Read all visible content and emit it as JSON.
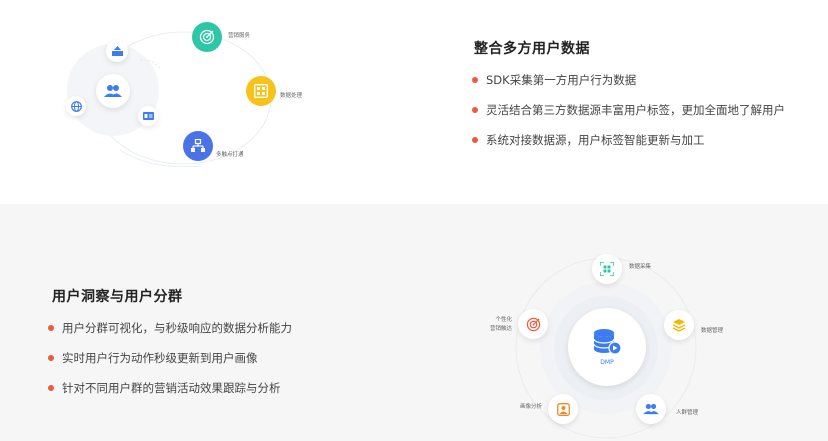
{
  "section1": {
    "title": "整合多方用户数据",
    "bullets": [
      "SDK采集第一方用户行为数据",
      "灵活结合第三方数据源丰富用户标签，更加全面地了解用户",
      "系统对接数据源，用户标签智能更新与加工"
    ],
    "diagram": {
      "labels": {
        "marketing": "营销服务",
        "data_process": "数据处理",
        "multi_channel": "多触点打通"
      },
      "icons": [
        "users-icon",
        "upload-tray-icon",
        "id-card-icon",
        "globe-icon",
        "target-icon",
        "grid-box-icon",
        "hierarchy-icon"
      ],
      "colors": {
        "teal": "#2ec7a5",
        "yellow": "#f7c21c",
        "blue": "#4a73ea",
        "icon_blue": "#3b7cf0"
      }
    }
  },
  "section2": {
    "title": "用户洞察与用户分群",
    "bullets": [
      "用户分群可视化，与秒级响应的数据分析能力",
      "实时用户行为动作秒级更新到用户画像",
      "针对不同用户群的营销活动效果跟踪与分析"
    ],
    "diagram": {
      "center_label": "DMP",
      "labels": {
        "collect": "数据采集",
        "manage": "数据管理",
        "crowd": "人群管理",
        "portrait": "画像分析",
        "personal_1": "个性化",
        "personal_2": "营销触达"
      },
      "icons": [
        "database-icon",
        "qr-scan-icon",
        "layers-icon",
        "users-icon",
        "portrait-icon",
        "target-icon"
      ],
      "colors": {
        "green": "#2ec7a5",
        "yellow": "#f5b800",
        "blue": "#3b7cf0",
        "orange": "#f08a24",
        "red": "#ee5a3c"
      }
    }
  },
  "colors": {
    "bullet": "#ee5a3c",
    "section2_bg": "#f6f6f6"
  }
}
